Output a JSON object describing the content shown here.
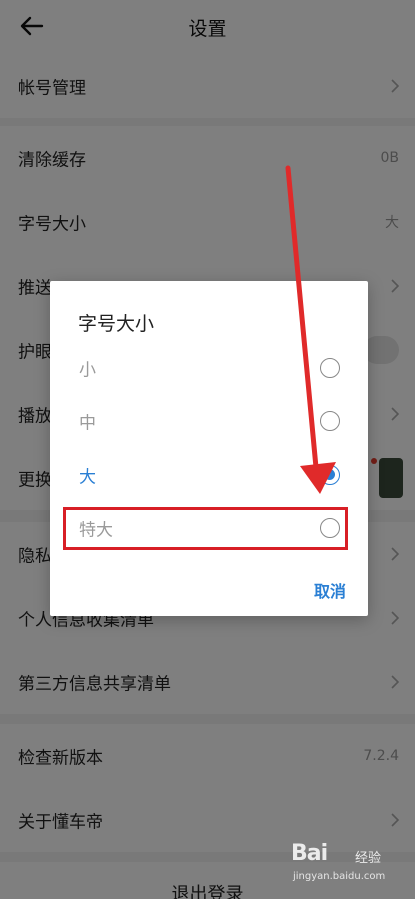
{
  "header": {
    "title": "设置",
    "back_icon": "back-arrow-icon"
  },
  "rows": [
    {
      "label": "帐号管理",
      "value": ""
    },
    {
      "label": "清除缓存",
      "value": "0B"
    },
    {
      "label": "字号大小",
      "value": "大"
    },
    {
      "label": "推送",
      "value": ""
    },
    {
      "label": "护眼",
      "value": ""
    },
    {
      "label": "播放",
      "value": ""
    },
    {
      "label": "更换",
      "value": ""
    },
    {
      "label": "隐私",
      "value": ""
    },
    {
      "label": "个人信息收集清单",
      "value": ""
    },
    {
      "label": "第三方信息共享清单",
      "value": ""
    },
    {
      "label": "检查新版本",
      "value": "7.2.4"
    },
    {
      "label": "关于懂车帝",
      "value": ""
    }
  ],
  "logout": {
    "label": "退出登录"
  },
  "dialog": {
    "title": "字号大小",
    "options": [
      {
        "label": "小",
        "checked": false
      },
      {
        "label": "中",
        "checked": false
      },
      {
        "label": "大",
        "checked": true
      },
      {
        "label": "特大",
        "checked": false
      }
    ],
    "cancel": "取消"
  },
  "watermark": {
    "logo": "Bai",
    "logo2": "经验",
    "url": "jingyan.baidu.com"
  },
  "colors": {
    "accent": "#2a7fd4",
    "annotation_red": "#d81f26"
  }
}
